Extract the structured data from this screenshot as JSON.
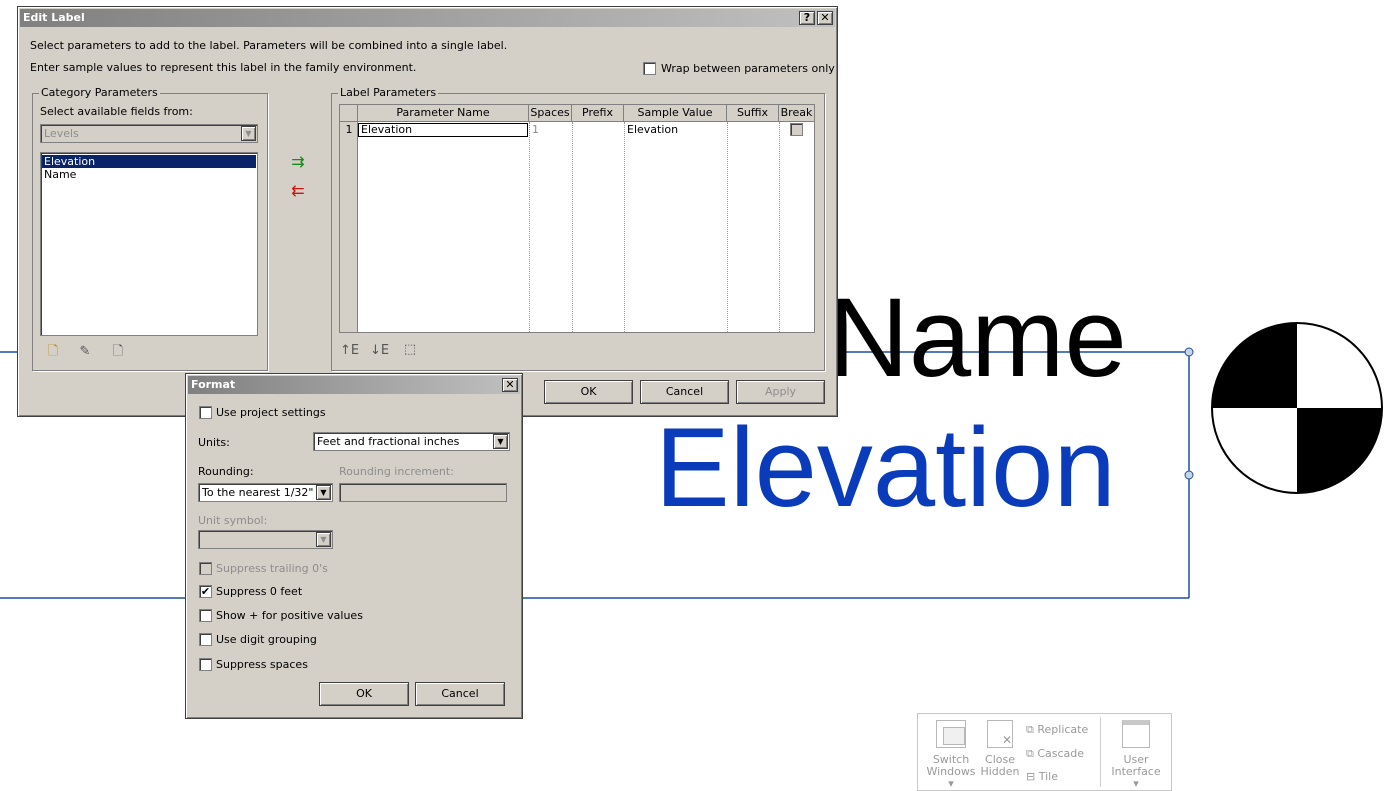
{
  "canvas": {
    "name_text": "Name",
    "elevation_text": "Elevation",
    "elevation_color": "#0a3bbb"
  },
  "edit_label": {
    "title": "Edit Label",
    "help_btn": "?",
    "close_btn": "✕",
    "instr1": "Select parameters to add to the label.  Parameters will be combined into a single label.",
    "instr2": "Enter sample values to represent this label in the family environment.",
    "wrap_label": "Wrap between parameters only",
    "category_group": "Category Parameters",
    "select_fields_label": "Select available fields from:",
    "category_value": "Levels",
    "fields": [
      "Elevation",
      "Name"
    ],
    "label_group": "Label Parameters",
    "columns": [
      "Parameter Name",
      "Spaces",
      "Prefix",
      "Sample Value",
      "Suffix",
      "Break"
    ],
    "rows": [
      {
        "num": "1",
        "parameter": "Elevation",
        "spaces": "1",
        "prefix": "",
        "sample": "Elevation",
        "suffix": ""
      }
    ],
    "ok": "OK",
    "cancel": "Cancel",
    "apply": "Apply"
  },
  "format": {
    "title": "Format",
    "close_btn": "✕",
    "use_project_settings": "Use project settings",
    "units_label": "Units:",
    "units_value": "Feet and fractional inches",
    "rounding_label": "Rounding:",
    "rounding_value": "To the nearest 1/32\"",
    "rounding_increment_label": "Rounding increment:",
    "rounding_increment_value": "",
    "unit_symbol_label": "Unit symbol:",
    "suppress_trailing": "Suppress trailing 0's",
    "suppress_zero_feet": "Suppress 0 feet",
    "show_plus": "Show + for positive values",
    "digit_grouping": "Use digit grouping",
    "suppress_spaces": "Suppress spaces",
    "ok": "OK",
    "cancel": "Cancel"
  },
  "ribbon": {
    "switch_windows": [
      "Switch",
      "Windows"
    ],
    "close_hidden": [
      "Close",
      "Hidden"
    ],
    "replicate": "Replicate",
    "cascade": "Cascade",
    "tile": "Tile",
    "user_interface": [
      "User",
      "Interface"
    ]
  }
}
